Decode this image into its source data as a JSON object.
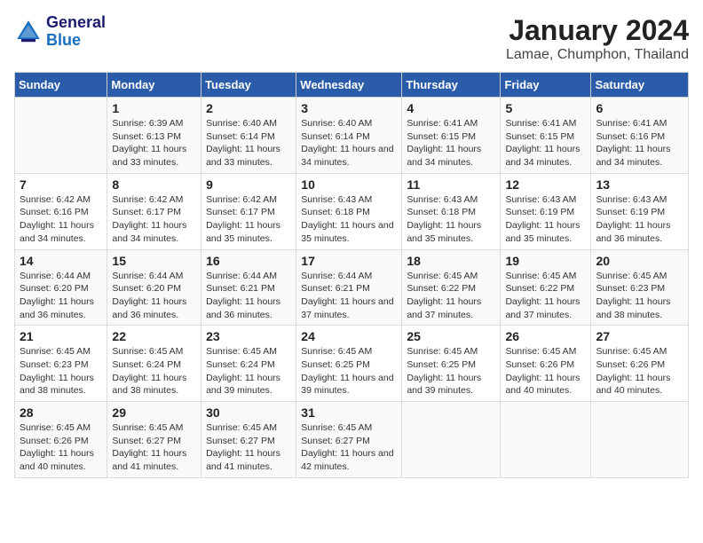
{
  "logo": {
    "line1": "General",
    "line2": "Blue"
  },
  "header": {
    "title": "January 2024",
    "subtitle": "Lamae, Chumphon, Thailand"
  },
  "weekdays": [
    "Sunday",
    "Monday",
    "Tuesday",
    "Wednesday",
    "Thursday",
    "Friday",
    "Saturday"
  ],
  "weeks": [
    [
      {
        "day": "",
        "sunrise": "",
        "sunset": "",
        "daylight": ""
      },
      {
        "day": "1",
        "sunrise": "Sunrise: 6:39 AM",
        "sunset": "Sunset: 6:13 PM",
        "daylight": "Daylight: 11 hours and 33 minutes."
      },
      {
        "day": "2",
        "sunrise": "Sunrise: 6:40 AM",
        "sunset": "Sunset: 6:14 PM",
        "daylight": "Daylight: 11 hours and 33 minutes."
      },
      {
        "day": "3",
        "sunrise": "Sunrise: 6:40 AM",
        "sunset": "Sunset: 6:14 PM",
        "daylight": "Daylight: 11 hours and 34 minutes."
      },
      {
        "day": "4",
        "sunrise": "Sunrise: 6:41 AM",
        "sunset": "Sunset: 6:15 PM",
        "daylight": "Daylight: 11 hours and 34 minutes."
      },
      {
        "day": "5",
        "sunrise": "Sunrise: 6:41 AM",
        "sunset": "Sunset: 6:15 PM",
        "daylight": "Daylight: 11 hours and 34 minutes."
      },
      {
        "day": "6",
        "sunrise": "Sunrise: 6:41 AM",
        "sunset": "Sunset: 6:16 PM",
        "daylight": "Daylight: 11 hours and 34 minutes."
      }
    ],
    [
      {
        "day": "7",
        "sunrise": "Sunrise: 6:42 AM",
        "sunset": "Sunset: 6:16 PM",
        "daylight": "Daylight: 11 hours and 34 minutes."
      },
      {
        "day": "8",
        "sunrise": "Sunrise: 6:42 AM",
        "sunset": "Sunset: 6:17 PM",
        "daylight": "Daylight: 11 hours and 34 minutes."
      },
      {
        "day": "9",
        "sunrise": "Sunrise: 6:42 AM",
        "sunset": "Sunset: 6:17 PM",
        "daylight": "Daylight: 11 hours and 35 minutes."
      },
      {
        "day": "10",
        "sunrise": "Sunrise: 6:43 AM",
        "sunset": "Sunset: 6:18 PM",
        "daylight": "Daylight: 11 hours and 35 minutes."
      },
      {
        "day": "11",
        "sunrise": "Sunrise: 6:43 AM",
        "sunset": "Sunset: 6:18 PM",
        "daylight": "Daylight: 11 hours and 35 minutes."
      },
      {
        "day": "12",
        "sunrise": "Sunrise: 6:43 AM",
        "sunset": "Sunset: 6:19 PM",
        "daylight": "Daylight: 11 hours and 35 minutes."
      },
      {
        "day": "13",
        "sunrise": "Sunrise: 6:43 AM",
        "sunset": "Sunset: 6:19 PM",
        "daylight": "Daylight: 11 hours and 36 minutes."
      }
    ],
    [
      {
        "day": "14",
        "sunrise": "Sunrise: 6:44 AM",
        "sunset": "Sunset: 6:20 PM",
        "daylight": "Daylight: 11 hours and 36 minutes."
      },
      {
        "day": "15",
        "sunrise": "Sunrise: 6:44 AM",
        "sunset": "Sunset: 6:20 PM",
        "daylight": "Daylight: 11 hours and 36 minutes."
      },
      {
        "day": "16",
        "sunrise": "Sunrise: 6:44 AM",
        "sunset": "Sunset: 6:21 PM",
        "daylight": "Daylight: 11 hours and 36 minutes."
      },
      {
        "day": "17",
        "sunrise": "Sunrise: 6:44 AM",
        "sunset": "Sunset: 6:21 PM",
        "daylight": "Daylight: 11 hours and 37 minutes."
      },
      {
        "day": "18",
        "sunrise": "Sunrise: 6:45 AM",
        "sunset": "Sunset: 6:22 PM",
        "daylight": "Daylight: 11 hours and 37 minutes."
      },
      {
        "day": "19",
        "sunrise": "Sunrise: 6:45 AM",
        "sunset": "Sunset: 6:22 PM",
        "daylight": "Daylight: 11 hours and 37 minutes."
      },
      {
        "day": "20",
        "sunrise": "Sunrise: 6:45 AM",
        "sunset": "Sunset: 6:23 PM",
        "daylight": "Daylight: 11 hours and 38 minutes."
      }
    ],
    [
      {
        "day": "21",
        "sunrise": "Sunrise: 6:45 AM",
        "sunset": "Sunset: 6:23 PM",
        "daylight": "Daylight: 11 hours and 38 minutes."
      },
      {
        "day": "22",
        "sunrise": "Sunrise: 6:45 AM",
        "sunset": "Sunset: 6:24 PM",
        "daylight": "Daylight: 11 hours and 38 minutes."
      },
      {
        "day": "23",
        "sunrise": "Sunrise: 6:45 AM",
        "sunset": "Sunset: 6:24 PM",
        "daylight": "Daylight: 11 hours and 39 minutes."
      },
      {
        "day": "24",
        "sunrise": "Sunrise: 6:45 AM",
        "sunset": "Sunset: 6:25 PM",
        "daylight": "Daylight: 11 hours and 39 minutes."
      },
      {
        "day": "25",
        "sunrise": "Sunrise: 6:45 AM",
        "sunset": "Sunset: 6:25 PM",
        "daylight": "Daylight: 11 hours and 39 minutes."
      },
      {
        "day": "26",
        "sunrise": "Sunrise: 6:45 AM",
        "sunset": "Sunset: 6:26 PM",
        "daylight": "Daylight: 11 hours and 40 minutes."
      },
      {
        "day": "27",
        "sunrise": "Sunrise: 6:45 AM",
        "sunset": "Sunset: 6:26 PM",
        "daylight": "Daylight: 11 hours and 40 minutes."
      }
    ],
    [
      {
        "day": "28",
        "sunrise": "Sunrise: 6:45 AM",
        "sunset": "Sunset: 6:26 PM",
        "daylight": "Daylight: 11 hours and 40 minutes."
      },
      {
        "day": "29",
        "sunrise": "Sunrise: 6:45 AM",
        "sunset": "Sunset: 6:27 PM",
        "daylight": "Daylight: 11 hours and 41 minutes."
      },
      {
        "day": "30",
        "sunrise": "Sunrise: 6:45 AM",
        "sunset": "Sunset: 6:27 PM",
        "daylight": "Daylight: 11 hours and 41 minutes."
      },
      {
        "day": "31",
        "sunrise": "Sunrise: 6:45 AM",
        "sunset": "Sunset: 6:27 PM",
        "daylight": "Daylight: 11 hours and 42 minutes."
      },
      {
        "day": "",
        "sunrise": "",
        "sunset": "",
        "daylight": ""
      },
      {
        "day": "",
        "sunrise": "",
        "sunset": "",
        "daylight": ""
      },
      {
        "day": "",
        "sunrise": "",
        "sunset": "",
        "daylight": ""
      }
    ]
  ]
}
